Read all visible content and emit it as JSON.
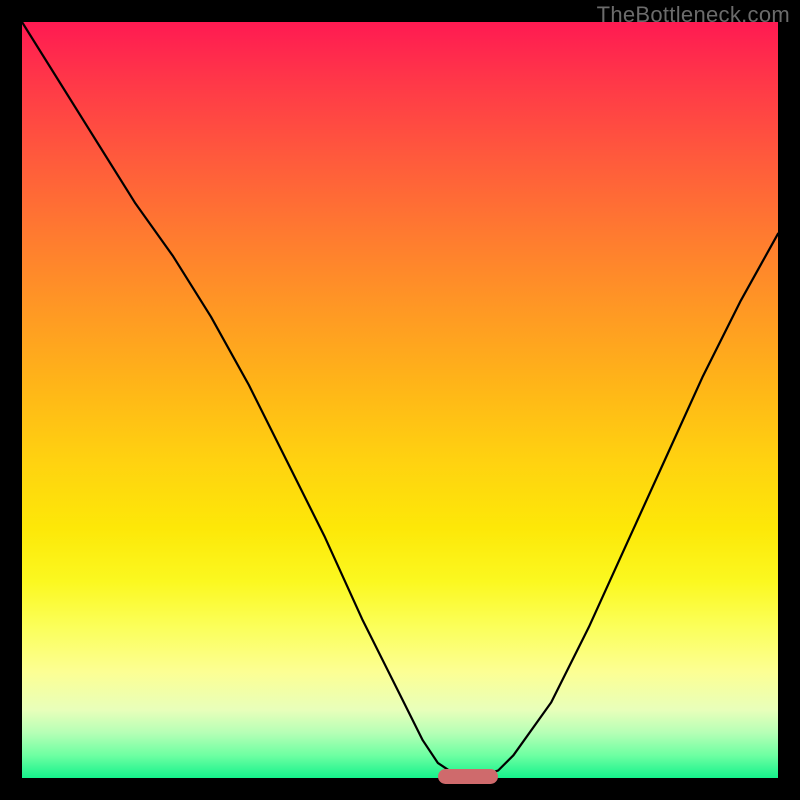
{
  "watermark": "TheBottleneck.com",
  "colors": {
    "frame": "#000000",
    "gradient_top": "#ff1a52",
    "gradient_mid": "#ffd210",
    "gradient_bottom": "#15f28c",
    "curve": "#000000",
    "marker": "#cf6a6c"
  },
  "chart_data": {
    "type": "line",
    "title": "",
    "xlabel": "",
    "ylabel": "",
    "xlim": [
      0,
      100
    ],
    "ylim": [
      0,
      100
    ],
    "grid": false,
    "legend": false,
    "annotations": [
      "TheBottleneck.com"
    ],
    "x": [
      0,
      5,
      10,
      15,
      20,
      25,
      30,
      35,
      40,
      45,
      50,
      53,
      55,
      58,
      60,
      63,
      65,
      70,
      75,
      80,
      85,
      90,
      95,
      100
    ],
    "values": [
      100,
      92,
      84,
      76,
      69,
      61,
      52,
      42,
      32,
      21,
      11,
      5,
      2,
      0,
      0,
      1,
      3,
      10,
      20,
      31,
      42,
      53,
      63,
      72
    ],
    "marker": {
      "x_start": 55,
      "x_end": 63,
      "y": 0
    }
  }
}
